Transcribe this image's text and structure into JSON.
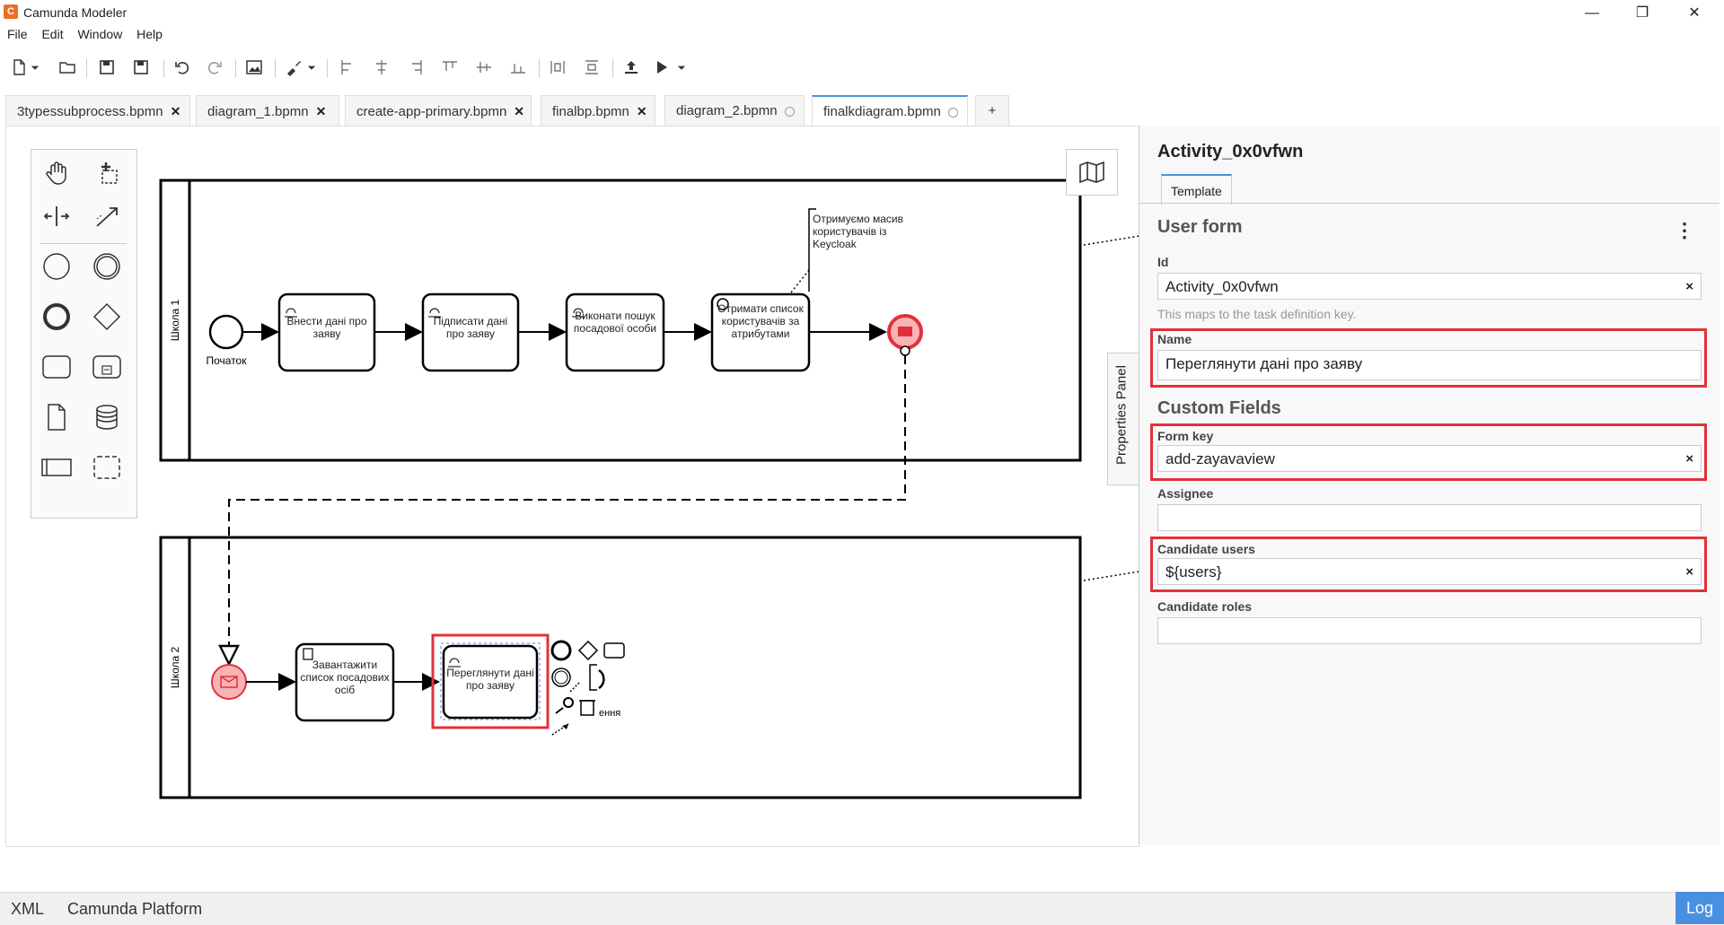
{
  "app": {
    "title": "Camunda Modeler",
    "icon_letter": "C"
  },
  "window_controls": {
    "minimize": "—",
    "restore": "❐",
    "close": "✕"
  },
  "menu": [
    "File",
    "Edit",
    "Window",
    "Help"
  ],
  "tabs": [
    {
      "label": "3typessubprocess.bpmn",
      "state": "close"
    },
    {
      "label": "diagram_1.bpmn",
      "state": "close"
    },
    {
      "label": "create-app-primary.bpmn",
      "state": "close"
    },
    {
      "label": "finalbp.bpmn",
      "state": "close"
    },
    {
      "label": "diagram_2.bpmn",
      "state": "unsaved"
    },
    {
      "label": "finalkdiagram.bpmn",
      "state": "unsaved",
      "active": true
    }
  ],
  "add_tab": "+",
  "diagram": {
    "lane1_label": "Школа 1",
    "lane2_label": "Школа 2",
    "start_label": "Початок",
    "task1": "Внести дані про заяву",
    "task2": "Підписати дані про заяву",
    "task3": "Виконати пошук посадової особи",
    "task4": "Отримати список користувачів за атрибутами",
    "annotation": "Отримуємо масив користувачів із Keycloak",
    "task5": "Завантажити список посадових осіб",
    "task6": "Переглянути дані про заяву",
    "context_label": "ення"
  },
  "properties_panel_tab": "Properties Panel",
  "props": {
    "element_id": "Activity_0x0vfwn",
    "template_tab": "Template",
    "group_user_form": "User form",
    "menu_dots": "⋮",
    "id_label": "Id",
    "id_value": "Activity_0x0vfwn",
    "id_hint": "This maps to the task definition key.",
    "name_label": "Name",
    "name_value": "Переглянути дані про заяву",
    "group_custom": "Custom Fields",
    "form_key_label": "Form key",
    "form_key_value": "add-zayavaview",
    "assignee_label": "Assignee",
    "assignee_value": "",
    "candidate_users_label": "Candidate users",
    "candidate_users_value": "${users}",
    "candidate_roles_label": "Candidate roles",
    "candidate_roles_value": "",
    "clear": "×"
  },
  "status_bar": {
    "xml": "XML",
    "platform": "Camunda Platform",
    "log": "Log"
  },
  "colors": {
    "accent": "#4a90e2",
    "highlight": "#e0313a",
    "event_fill": "#f8b4b4",
    "event_stroke": "#e0313a"
  }
}
